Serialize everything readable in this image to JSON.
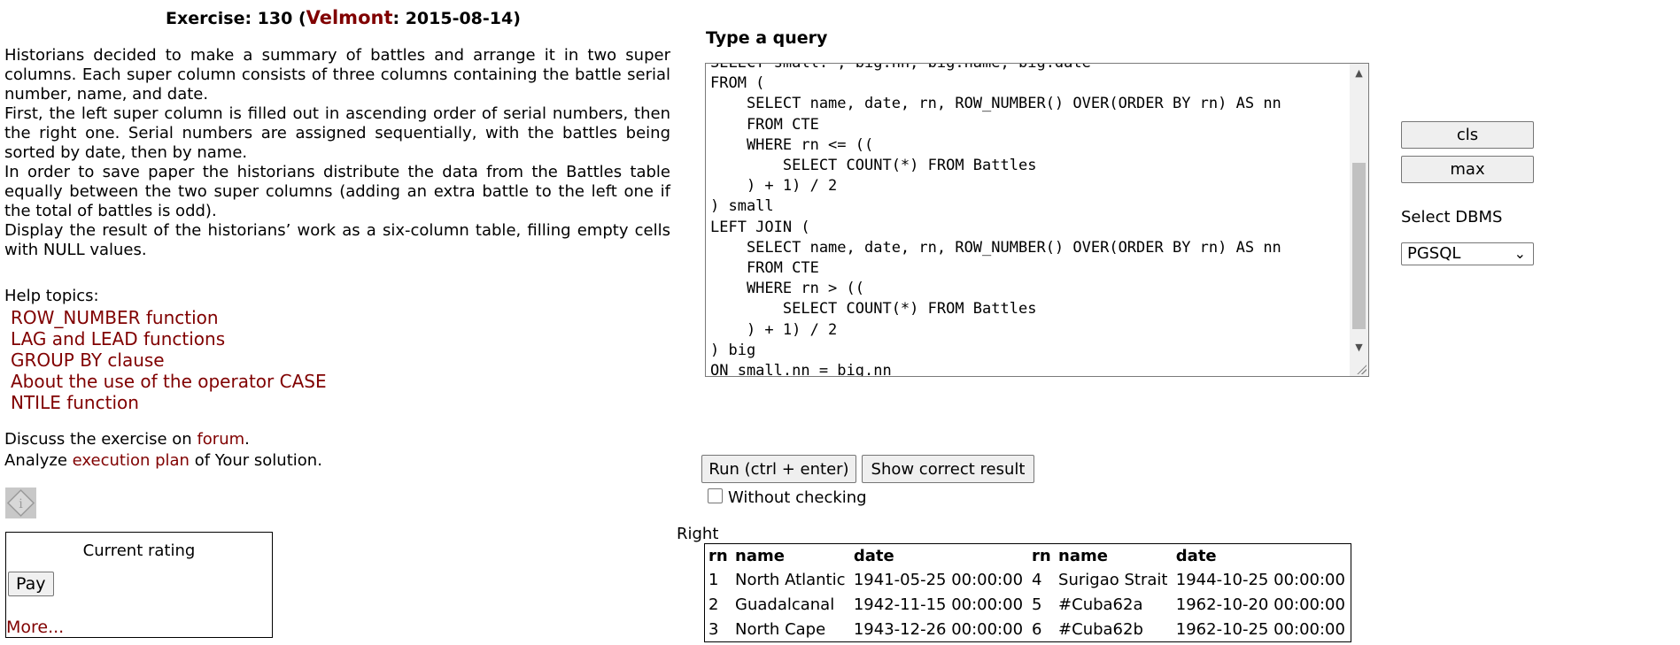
{
  "exercise": {
    "prefix": "Exercise: 130 (",
    "author": "Velmont",
    "suffix": ": 2015-08-14)"
  },
  "task": {
    "paragraphs": [
      "Historians decided to make a summary of battles and arrange it in two super columns. Each super column consists of three columns containing the battle serial number, name, and date.",
      "First, the left super column is filled out in ascending order of serial numbers, then the right one. Serial numbers are assigned sequentially, with the battles being sorted by date, then by name.",
      "In order to save paper the historians distribute the data from the Battles table equally between the two super columns (adding an extra battle to the left one if the total of battles is odd).",
      "Display the result of the historians’ work as a six-column table, filling empty cells with NULL values."
    ]
  },
  "help": {
    "label": "Help topics:",
    "topics": [
      "ROW_NUMBER function",
      "LAG and LEAD functions",
      "GROUP BY clause",
      "About the use of the operator CASE",
      "NTILE function"
    ]
  },
  "discuss": {
    "prefix": "Discuss the exercise on ",
    "link": "forum",
    "suffix": "."
  },
  "analyze": {
    "prefix": "Analyze ",
    "link": "execution plan",
    "suffix": " of Your solution."
  },
  "rating": {
    "title": "Current rating",
    "pay_label": "Pay",
    "more_label": "More..."
  },
  "query": {
    "label": "Type a query",
    "code": "SELECT small.*, big.nn, big.name, big.date\nFROM (\n    SELECT name, date, rn, ROW_NUMBER() OVER(ORDER BY rn) AS nn\n    FROM CTE\n    WHERE rn <= ((\n        SELECT COUNT(*) FROM Battles\n    ) + 1) / 2\n) small\nLEFT JOIN (\n    SELECT name, date, rn, ROW_NUMBER() OVER(ORDER BY rn) AS nn\n    FROM CTE\n    WHERE rn > ((\n        SELECT COUNT(*) FROM Battles\n    ) + 1) / 2\n) big\nON small.nn = big.nn"
  },
  "controls": {
    "cls_label": "cls",
    "max_label": "max",
    "dbms_label": "Select DBMS",
    "dbms_selected": "PGSQL",
    "run_label": "Run (ctrl + enter)",
    "correct_label": "Show correct result",
    "without_checking_label": "Without checking"
  },
  "result": {
    "status": "Right",
    "headers": [
      "rn",
      "name",
      "date",
      "rn",
      "name",
      "date"
    ],
    "rows": [
      [
        "1",
        "North Atlantic",
        "1941-05-25 00:00:00",
        "4",
        "Surigao Strait",
        "1944-10-25 00:00:00"
      ],
      [
        "2",
        "Guadalcanal",
        "1942-11-15 00:00:00",
        "5",
        "#Cuba62a",
        "1962-10-20 00:00:00"
      ],
      [
        "3",
        "North Cape",
        "1943-12-26 00:00:00",
        "6",
        "#Cuba62b",
        "1962-10-25 00:00:00"
      ]
    ]
  },
  "colors": {
    "link": "#800000"
  }
}
